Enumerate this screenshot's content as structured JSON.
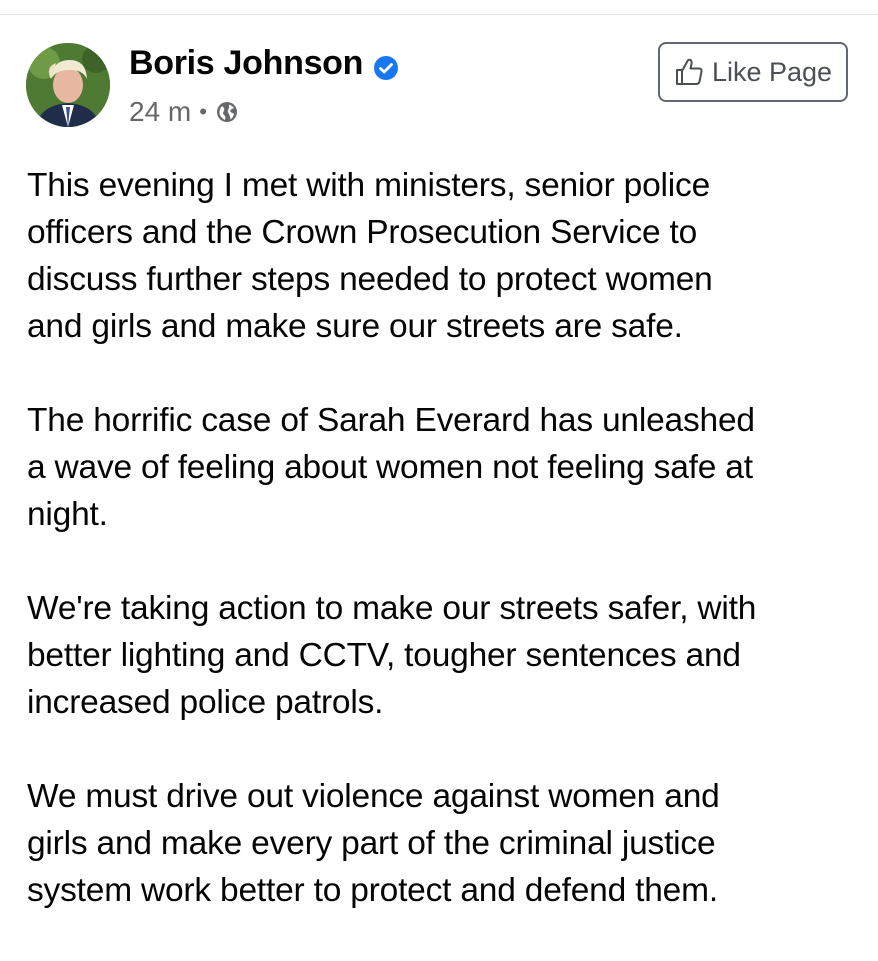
{
  "post": {
    "author": "Boris Johnson",
    "verified": true,
    "time": "24 m",
    "privacy_icon": "globe-icon",
    "like_page_label": "Like Page",
    "paragraphs": [
      "This evening I met with ministers, senior police\nofficers and the Crown Prosecution Service to\ndiscuss further steps needed to protect women\nand girls and make sure our streets are safe.",
      "The horrific case of Sarah Everard has unleashed\na wave of feeling about women not feeling safe at\nnight.",
      "We're taking action to make our streets safer, with\nbetter lighting and CCTV, tougher sentences and\nincreased police patrols.",
      "We must drive out violence against women and\ngirls and make every part of the criminal justice\nsystem work better to protect and defend them."
    ]
  },
  "colors": {
    "verified_badge": "#1877f2",
    "meta_text": "#65676b",
    "body_text": "#050505"
  }
}
